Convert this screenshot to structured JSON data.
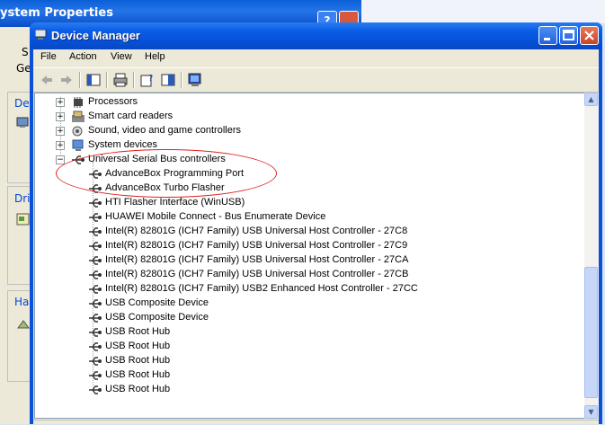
{
  "background_window": {
    "title": "ystem Properties",
    "help_glyph": "?",
    "tab_fragment_top": "S",
    "tab_fragment_left": "Ge",
    "group_labels": [
      "Dev",
      "Driv",
      "Har"
    ]
  },
  "window": {
    "title": "Device Manager",
    "icon": "computer-manager-icon"
  },
  "menu": [
    "File",
    "Action",
    "View",
    "Help"
  ],
  "toolbar": {
    "buttons": [
      "back-arrow-icon",
      "forward-arrow-icon",
      "properties-pane-icon",
      "print-icon",
      "help-icon",
      "show-hide-console-tree-icon",
      "scan-hardware-icon"
    ]
  },
  "tree": {
    "categories": [
      {
        "label": "Processors",
        "icon": "processor-icon",
        "state": "collapsed"
      },
      {
        "label": "Smart card readers",
        "icon": "smart-card-icon",
        "state": "collapsed"
      },
      {
        "label": "Sound, video and game controllers",
        "icon": "sound-icon",
        "state": "collapsed"
      },
      {
        "label": "System devices",
        "icon": "system-device-icon",
        "state": "collapsed"
      },
      {
        "label": "Universal Serial Bus controllers",
        "icon": "usb-icon",
        "state": "expanded"
      }
    ],
    "usb_devices": [
      "AdvanceBox Programming Port",
      "AdvanceBox Turbo Flasher",
      "HTI Flasher Interface (WinUSB)",
      "HUAWEI Mobile Connect - Bus Enumerate Device",
      "Intel(R) 82801G (ICH7 Family) USB Universal Host Controller - 27C8",
      "Intel(R) 82801G (ICH7 Family) USB Universal Host Controller - 27C9",
      "Intel(R) 82801G (ICH7 Family) USB Universal Host Controller - 27CA",
      "Intel(R) 82801G (ICH7 Family) USB Universal Host Controller - 27CB",
      "Intel(R) 82801G (ICH7 Family) USB2 Enhanced Host Controller - 27CC",
      "USB Composite Device",
      "USB Composite Device",
      "USB Root Hub",
      "USB Root Hub",
      "USB Root Hub",
      "USB Root Hub",
      "USB Root Hub"
    ],
    "expander_collapsed": "+",
    "expander_expanded": "−"
  },
  "scrollbar": {
    "up_glyph": "▲",
    "down_glyph": "▼"
  },
  "colors": {
    "highlight_ellipse": "#e02020",
    "title_bar": "#0a5ee6"
  }
}
